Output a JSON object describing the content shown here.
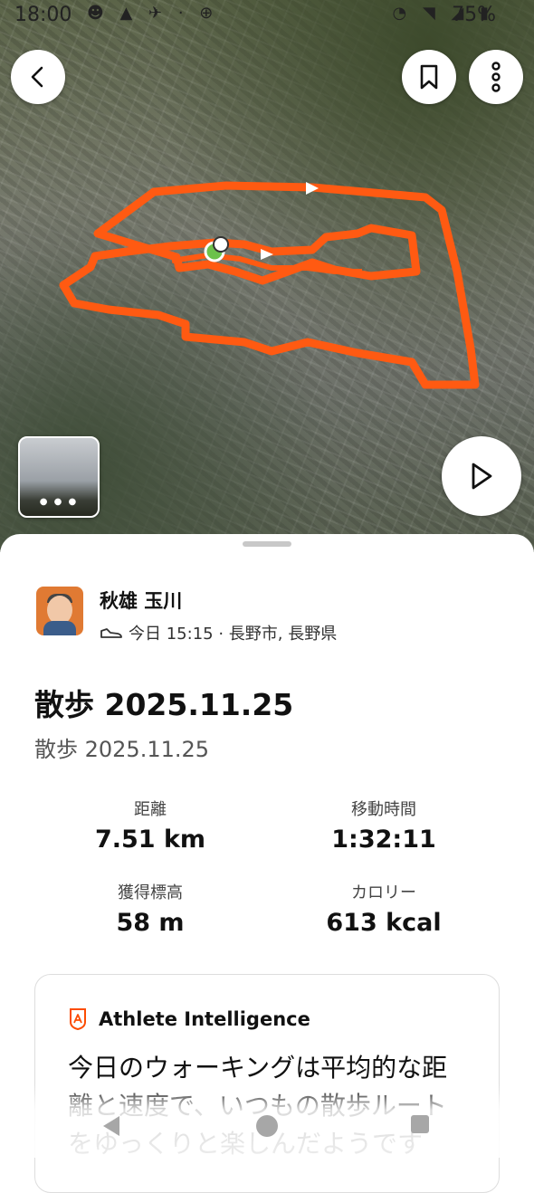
{
  "status_bar": {
    "time": "18:00",
    "battery": "75%"
  },
  "user": {
    "name": "秋雄 玉川",
    "meta": "今日 15:15 · 長野市, 長野県"
  },
  "activity": {
    "title": "散歩 2025.11.25",
    "subtitle": "散歩 2025.11.25"
  },
  "stats": [
    {
      "label": "距離",
      "value": "7.51 km"
    },
    {
      "label": "移動時間",
      "value": "1:32:11"
    },
    {
      "label": "獲得標高",
      "value": "58 m"
    },
    {
      "label": "カロリー",
      "value": "613 kcal"
    }
  ],
  "insight": {
    "title": "Athlete Intelligence",
    "text": "今日のウォーキングは平均的な距離と速度で、いつもの散歩ルートをゆっくりと楽しんだようです"
  },
  "colors": {
    "route": "#ff5a12",
    "start_marker": "#6cc24a",
    "accent": "#fc4c02"
  },
  "icons": [
    "back-arrow-icon",
    "bookmark-icon",
    "more-vertical-icon",
    "play-icon",
    "shoe-icon",
    "athlete-intelligence-icon"
  ]
}
